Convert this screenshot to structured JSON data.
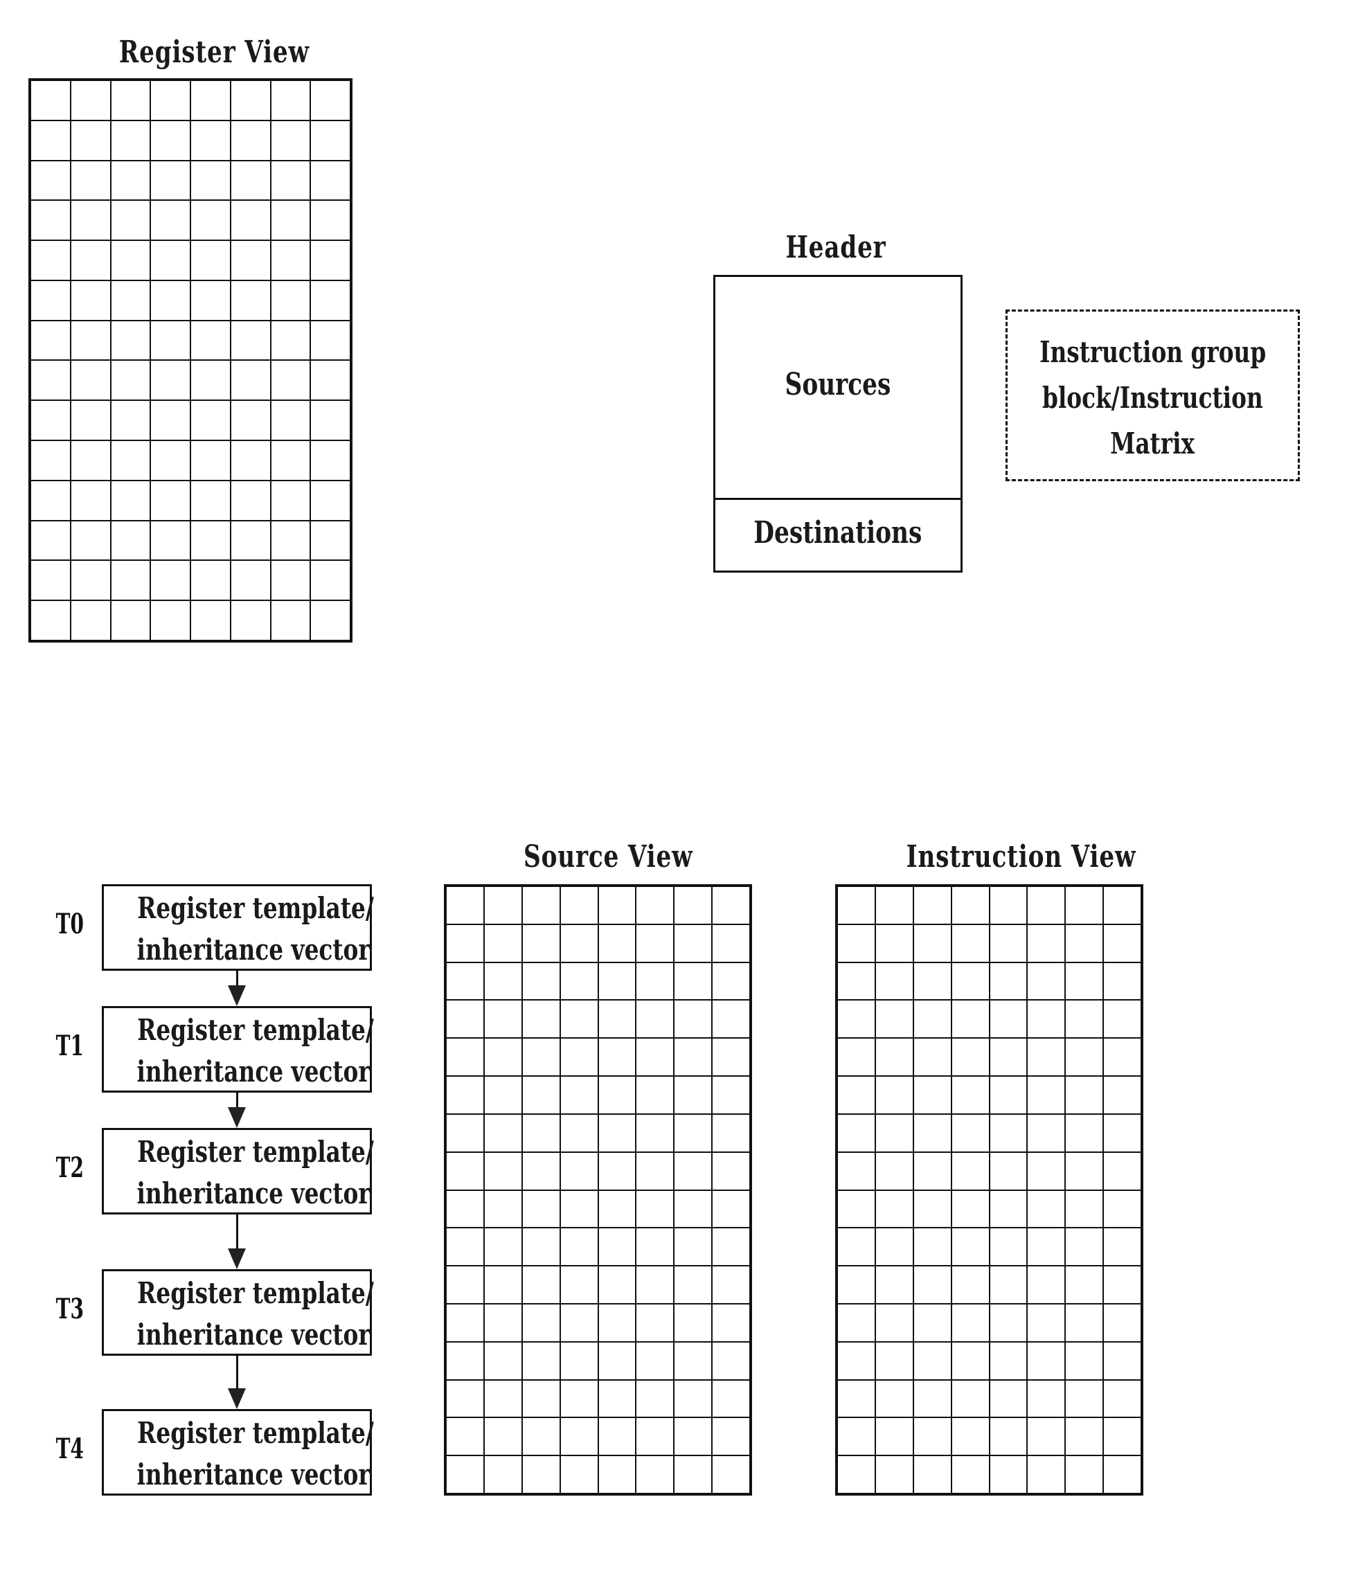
{
  "register_view": {
    "title": "Register View",
    "rows": 14,
    "cols": 8
  },
  "header_block": {
    "title": "Header",
    "sources_label": "Sources",
    "destinations_label": "Destinations"
  },
  "instruction_group": {
    "lines": [
      "Instruction group",
      "block/Instruction",
      "Matrix"
    ]
  },
  "templates": [
    {
      "time": "T0",
      "line1": "Register template/",
      "line2": "inheritance vector"
    },
    {
      "time": "T1",
      "line1": "Register template/",
      "line2": "inheritance vector"
    },
    {
      "time": "T2",
      "line1": "Register template/",
      "line2": "inheritance vector"
    },
    {
      "time": "T3",
      "line1": "Register template/",
      "line2": "inheritance vector"
    },
    {
      "time": "T4",
      "line1": "Register template/",
      "line2": "inheritance vector"
    }
  ],
  "source_view": {
    "title": "Source View",
    "rows": 16,
    "cols": 8
  },
  "instruction_view": {
    "title": "Instruction View",
    "rows": 16,
    "cols": 8
  }
}
